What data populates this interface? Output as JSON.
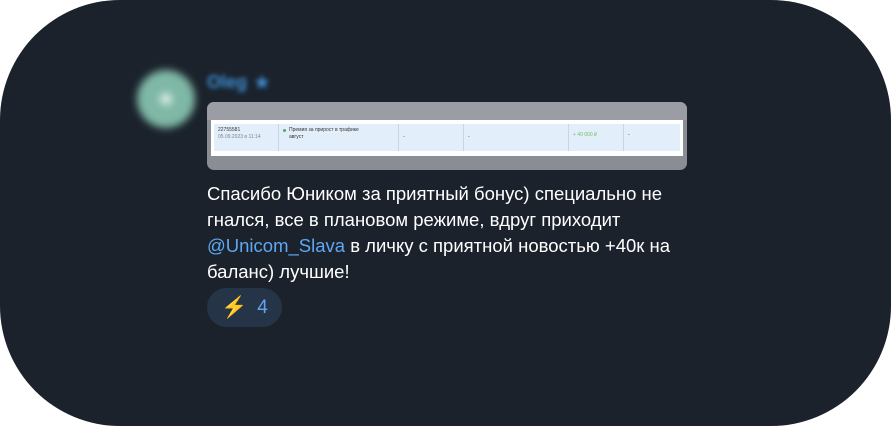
{
  "sender": {
    "name": "Oleg",
    "badge_icon": "star-icon",
    "name_color": "#3e8fd3"
  },
  "attachment": {
    "row": {
      "id": "22755581",
      "datetime": "05.09.2023 в 11:14",
      "description_line1": "Премия за прирост в трафике",
      "description_line2": "август",
      "col3": "-",
      "col4": "-",
      "amount": "+ 40 000 ₽",
      "col6": "-"
    }
  },
  "message": {
    "text_before": "Спасибо Юником за приятный бонус) специально не гнался, все в плановом режиме, вдруг приходит ",
    "mention": "@Unicom_Slava",
    "text_after": " в личку с приятной новостью +40к на баланс) лучшие!",
    "mention_color": "#5ea8f2"
  },
  "reaction": {
    "emoji_icon": "lightning-icon",
    "emoji": "⚡",
    "count": "4",
    "count_color": "#62a5ee"
  },
  "colors": {
    "background": "#1b222c",
    "reaction_bg": "#263448"
  }
}
